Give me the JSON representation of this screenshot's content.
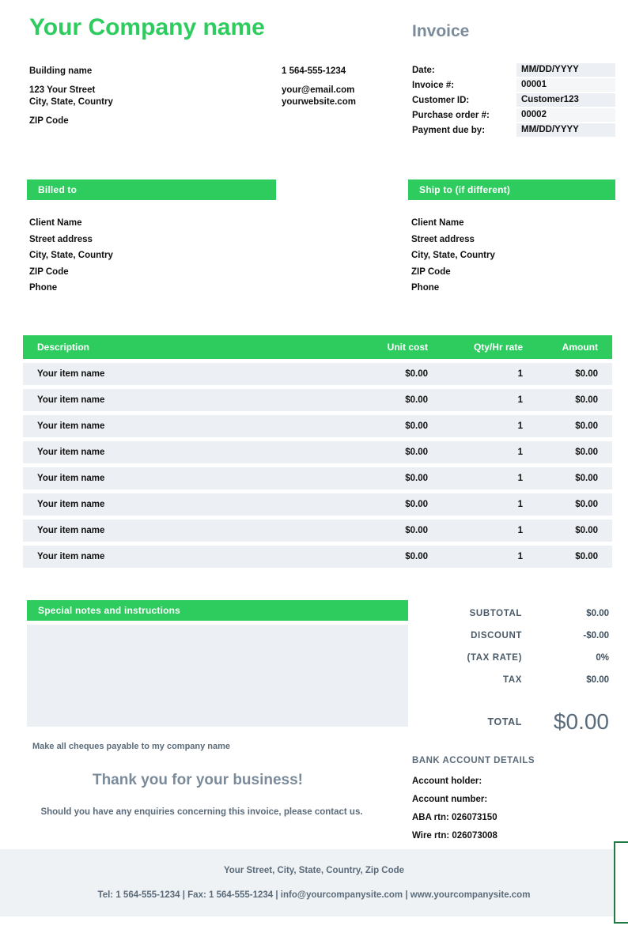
{
  "company": {
    "name": "Your Company name",
    "address": [
      "Building name",
      "123 Your Street",
      "City, State, Country",
      "ZIP Code"
    ],
    "contact": [
      "1 564-555-1234",
      "your@email.com",
      "yourwebsite.com"
    ]
  },
  "invoice": {
    "title": "Invoice",
    "meta": [
      {
        "label": "Date:",
        "value": "MM/DD/YYYY"
      },
      {
        "label": "Invoice #:",
        "value": "00001"
      },
      {
        "label": "Customer ID:",
        "value": "Customer123"
      },
      {
        "label": "Purchase order #:",
        "value": "00002"
      },
      {
        "label": "Payment due by:",
        "value": "MM/DD/YYYY"
      }
    ]
  },
  "billed_to": {
    "heading": "Billed to",
    "lines": [
      "Client Name",
      "Street address",
      "City, State, Country",
      "ZIP Code",
      "Phone"
    ]
  },
  "ship_to": {
    "heading": "Ship to (if different)",
    "lines": [
      "Client Name",
      "Street address",
      "City, State, Country",
      "ZIP Code",
      "Phone"
    ]
  },
  "items_table": {
    "columns": [
      "Description",
      "Unit cost",
      "Qty/Hr rate",
      "Amount"
    ],
    "rows": [
      {
        "description": "Your item name",
        "unit_cost": "$0.00",
        "qty": "1",
        "amount": "$0.00"
      },
      {
        "description": "Your item name",
        "unit_cost": "$0.00",
        "qty": "1",
        "amount": "$0.00"
      },
      {
        "description": "Your item name",
        "unit_cost": "$0.00",
        "qty": "1",
        "amount": "$0.00"
      },
      {
        "description": "Your item name",
        "unit_cost": "$0.00",
        "qty": "1",
        "amount": "$0.00"
      },
      {
        "description": "Your item name",
        "unit_cost": "$0.00",
        "qty": "1",
        "amount": "$0.00"
      },
      {
        "description": "Your item name",
        "unit_cost": "$0.00",
        "qty": "1",
        "amount": "$0.00"
      },
      {
        "description": "Your item name",
        "unit_cost": "$0.00",
        "qty": "1",
        "amount": "$0.00"
      },
      {
        "description": "Your item name",
        "unit_cost": "$0.00",
        "qty": "1",
        "amount": "$0.00"
      }
    ]
  },
  "notes": {
    "heading": "Special notes and instructions",
    "body": ""
  },
  "totals": [
    {
      "label": "SUBTOTAL",
      "value": "$0.00"
    },
    {
      "label": "DISCOUNT",
      "value": "-$0.00"
    },
    {
      "label": "(TAX RATE)",
      "value": "0%"
    },
    {
      "label": "TAX",
      "value": "$0.00"
    }
  ],
  "grand_total": {
    "label": "TOTAL",
    "value": "$0.00"
  },
  "closing": {
    "cheques": "Make all cheques payable to my company name",
    "thanks": "Thank you for your business!",
    "enquiries": "Should you have any enquiries concerning this invoice, please contact us."
  },
  "bank": {
    "title": "BANK ACCOUNT DETAILS",
    "lines": [
      "Account holder:",
      "Account number:",
      "ABA rtn: 026073150",
      "Wire rtn: 026073008"
    ]
  },
  "footer": {
    "address": "Your Street, City, State, Country, Zip Code",
    "contact": "Tel: 1 564-555-1234 | Fax: 1 564-555-1234 | info@yourcompanysite.com |  www.yourcompanysite.com"
  },
  "colors": {
    "accent_green": "#2ecc5f",
    "frame_green": "#1f7a43",
    "muted_blue": "#7b8b9a",
    "row_grey": "#eceff3",
    "footer_grey": "#eef2f5"
  }
}
